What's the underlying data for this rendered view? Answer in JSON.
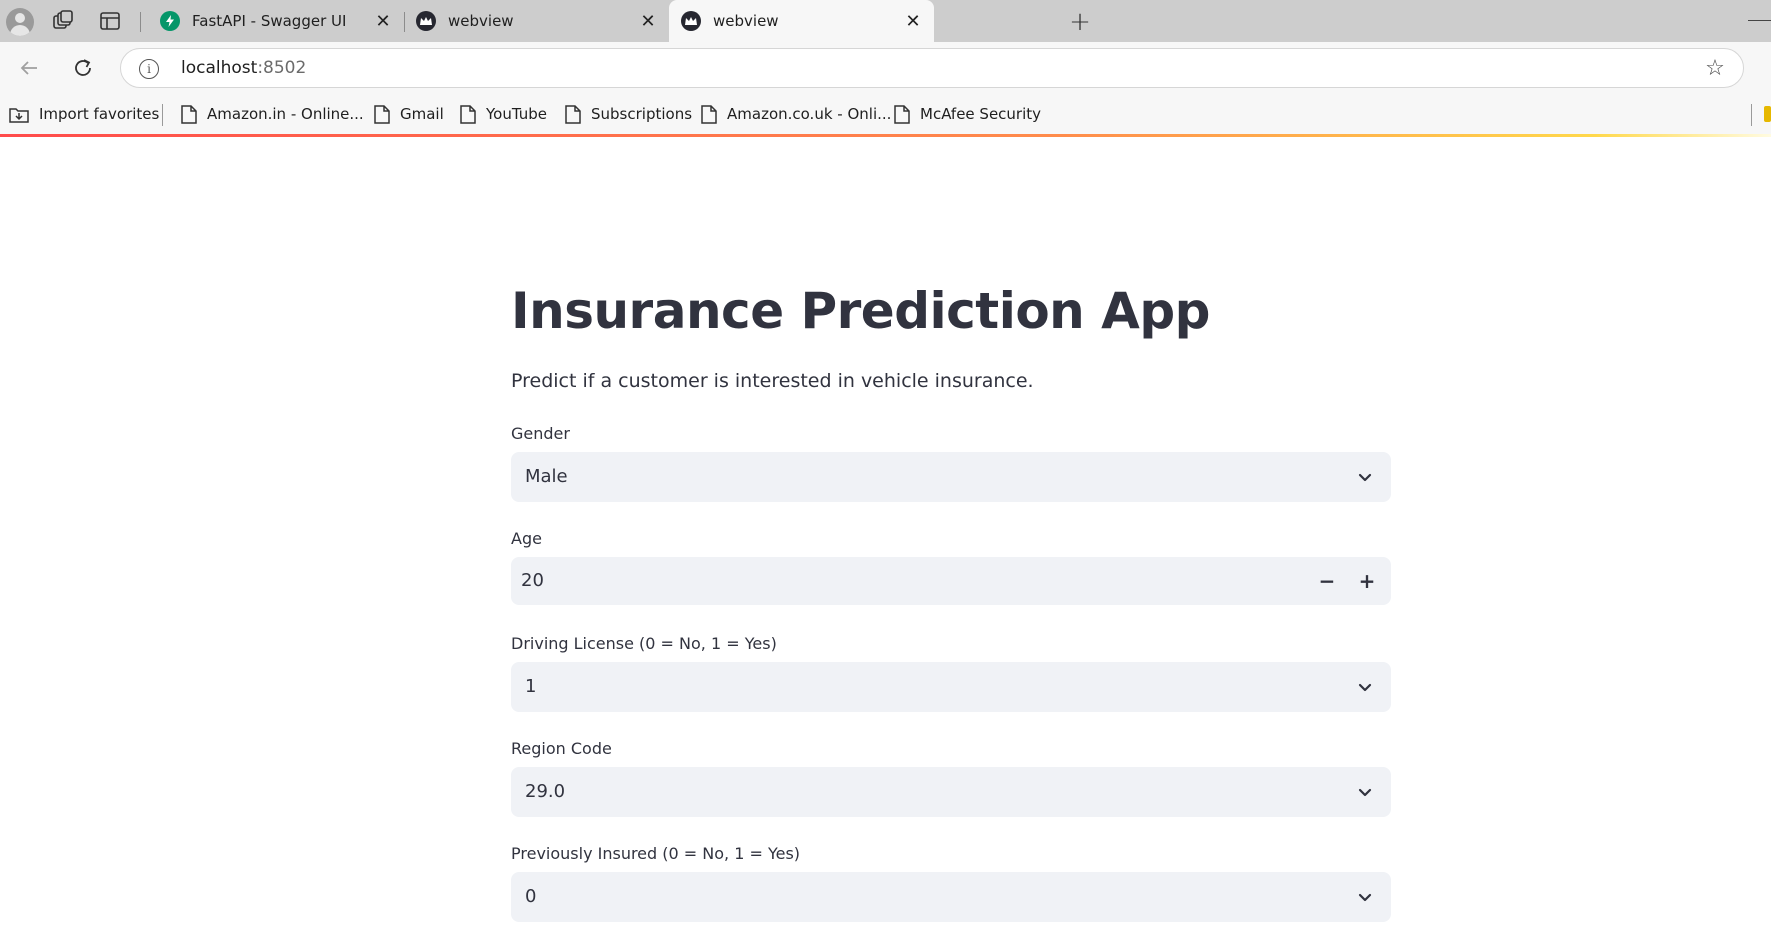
{
  "browser": {
    "tabs": [
      {
        "title": "FastAPI - Swagger UI",
        "active": false
      },
      {
        "title": "webview",
        "active": false
      },
      {
        "title": "webview",
        "active": true
      }
    ],
    "address": {
      "host": "localhost",
      "port": ":8502"
    },
    "bookmarks": [
      {
        "label": "Import favorites"
      },
      {
        "label": "Amazon.in - Online..."
      },
      {
        "label": "Gmail"
      },
      {
        "label": "YouTube"
      },
      {
        "label": "Subscriptions"
      },
      {
        "label": "Amazon.co.uk - Onli..."
      },
      {
        "label": "McAfee Security"
      }
    ],
    "colors": {
      "run_indicator_start": "#ff4b4b",
      "run_indicator_end": "#ffd84b",
      "fastapi_favicon": "#059669"
    }
  },
  "app": {
    "title": "Insurance Prediction App",
    "subtitle": "Predict if a customer is interested in vehicle insurance.",
    "fields": {
      "gender": {
        "label": "Gender",
        "value": "Male"
      },
      "age": {
        "label": "Age",
        "value": "20"
      },
      "driving_license": {
        "label": "Driving License (0 = No, 1 = Yes)",
        "value": "1"
      },
      "region_code": {
        "label": "Region Code",
        "value": "29.0"
      },
      "previously_insured": {
        "label": "Previously Insured (0 = No, 1 = Yes)",
        "value": "0"
      }
    },
    "colors": {
      "text": "#31333f",
      "input_bg": "#f0f2f6"
    }
  }
}
